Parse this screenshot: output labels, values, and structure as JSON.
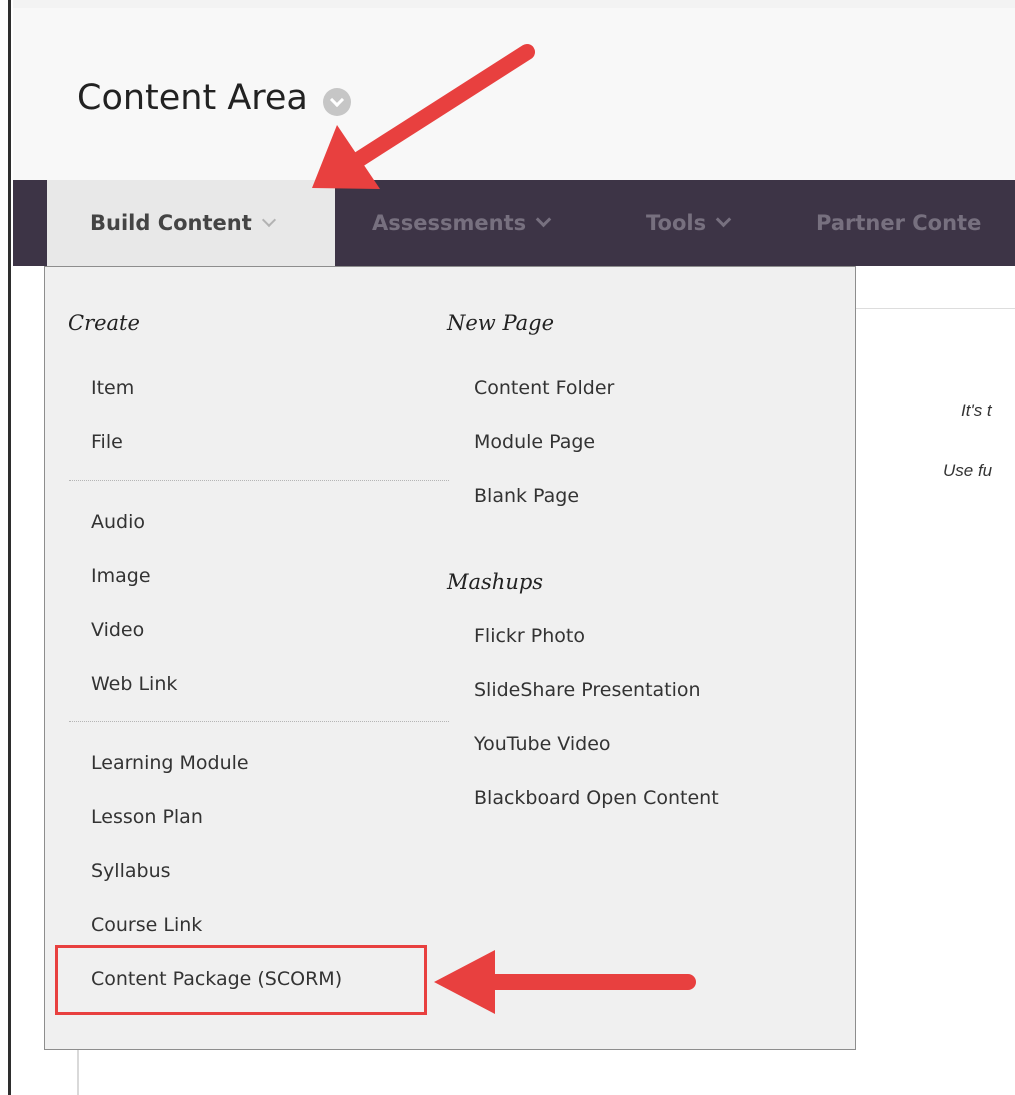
{
  "header": {
    "title": "Content Area"
  },
  "nav": {
    "tabs": [
      {
        "label": "Build Content"
      },
      {
        "label": "Assessments"
      },
      {
        "label": "Tools"
      },
      {
        "label": "Partner Conte"
      }
    ]
  },
  "menu": {
    "create_heading": "Create",
    "create_group1": [
      "Item",
      "File"
    ],
    "create_group2": [
      "Audio",
      "Image",
      "Video",
      "Web Link"
    ],
    "create_group3": [
      "Learning Module",
      "Lesson Plan",
      "Syllabus",
      "Course Link",
      "Content Package (SCORM)"
    ],
    "newpage_heading": "New Page",
    "newpage_items": [
      "Content Folder",
      "Module Page",
      "Blank Page"
    ],
    "mashups_heading": "Mashups",
    "mashups_items": [
      "Flickr Photo",
      "SlideShare Presentation",
      "YouTube Video",
      "Blackboard Open Content"
    ]
  },
  "content": {
    "hint_line1": "It's t",
    "hint_line2": "Use fu"
  },
  "colors": {
    "nav_bg": "#3d3446",
    "annotation": "#e8403f",
    "menu_bg": "#f0f0f0"
  }
}
